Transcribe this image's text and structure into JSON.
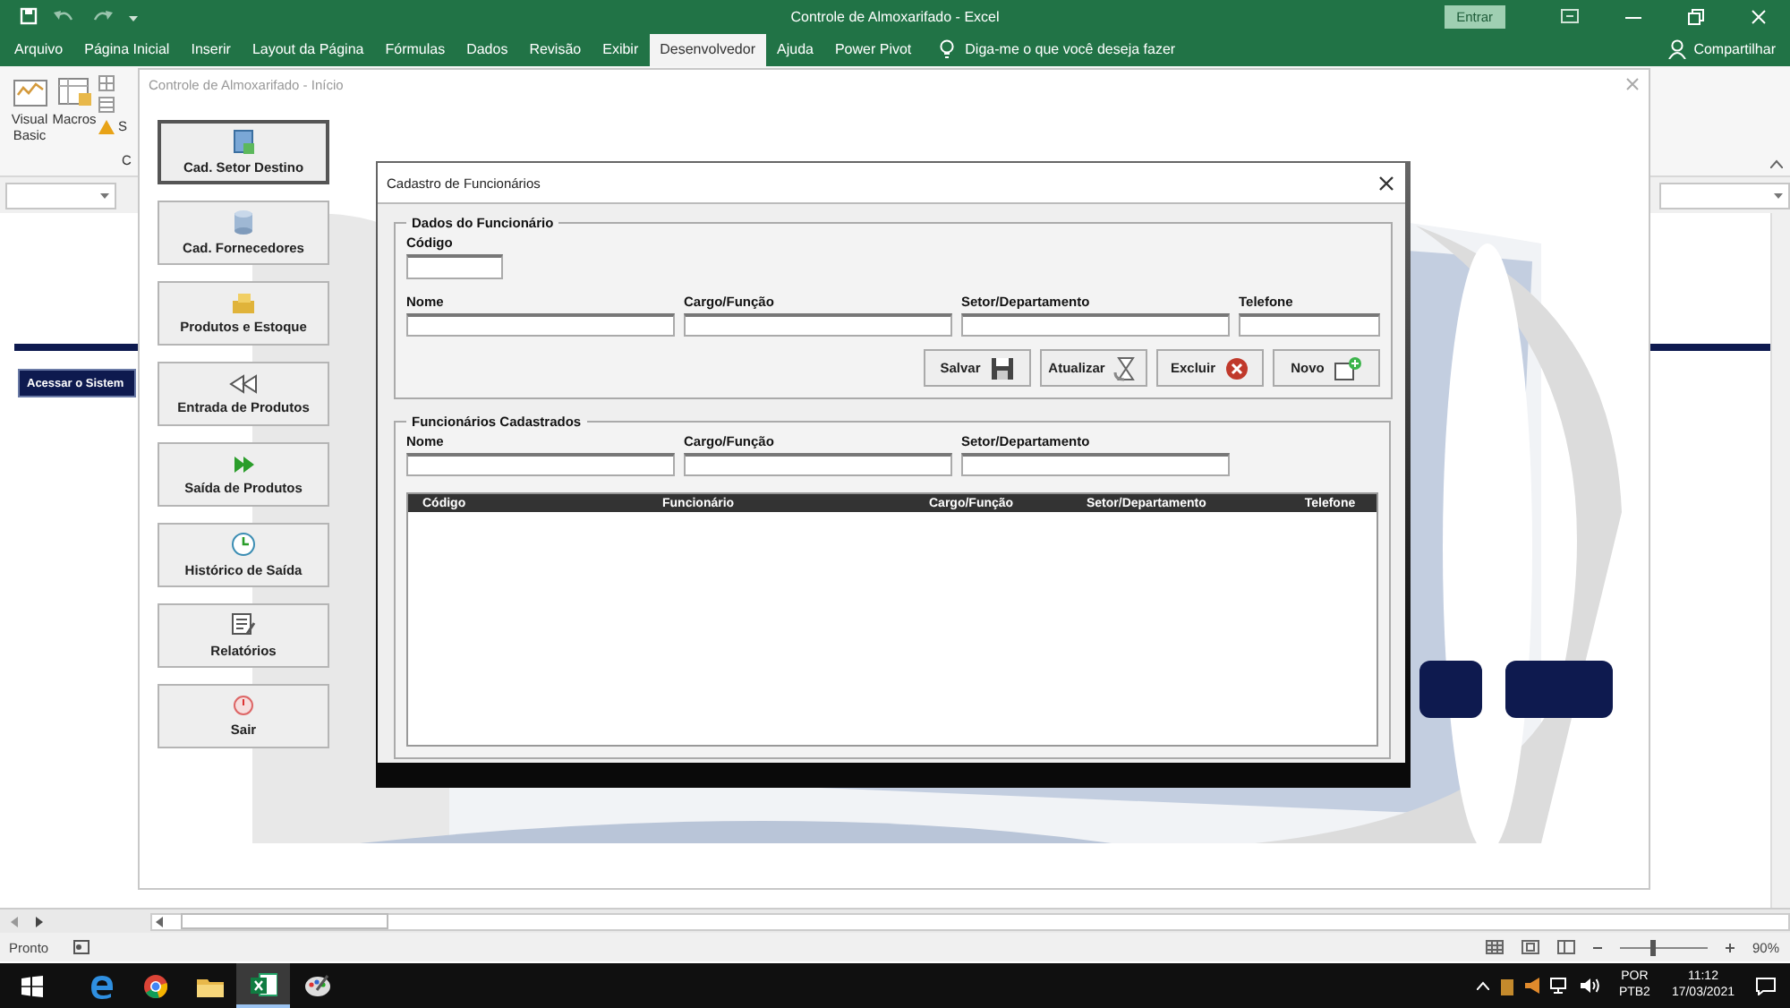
{
  "excel": {
    "title": "Controle de Almoxarifado - Excel",
    "signin": "Entrar",
    "ribbon_tabs": [
      {
        "label": "Arquivo",
        "selected": false
      },
      {
        "label": "Página Inicial",
        "selected": false
      },
      {
        "label": "Inserir",
        "selected": false
      },
      {
        "label": "Layout da Página",
        "selected": false
      },
      {
        "label": "Fórmulas",
        "selected": false
      },
      {
        "label": "Dados",
        "selected": false
      },
      {
        "label": "Revisão",
        "selected": false
      },
      {
        "label": "Exibir",
        "selected": false
      },
      {
        "label": "Desenvolvedor",
        "selected": true
      },
      {
        "label": "Ajuda",
        "selected": false
      },
      {
        "label": "Power Pivot",
        "selected": false
      }
    ],
    "tell_me": "Diga-me o que você deseja fazer",
    "share": "Compartilhar",
    "ribbon_buttons": [
      {
        "label": "Visual Basic",
        "kind": "vba"
      },
      {
        "label": "Macros",
        "kind": "macros"
      }
    ],
    "ribbon_small": "S",
    "group_label": "C",
    "sheet_button": "Acessar o Sistem",
    "status": "Pronto",
    "zoom": "90%",
    "zoom_slider": {
      "level": 0.37
    }
  },
  "form": {
    "title": "Controle de Almoxarifado - Início",
    "menu": [
      {
        "label": "Cad. Setor Destino",
        "kind": "sector",
        "focused": true
      },
      {
        "label": "Cad. Fornecedores",
        "kind": "supplier",
        "focused": false
      },
      {
        "label": "Produtos e Estoque",
        "kind": "products",
        "focused": false
      },
      {
        "label": "Entrada de Produtos",
        "kind": "entry",
        "focused": false
      },
      {
        "label": "Saída de Produtos",
        "kind": "exit",
        "focused": false
      },
      {
        "label": "Histórico de Saída",
        "kind": "history",
        "focused": false
      },
      {
        "label": "Relatórios",
        "kind": "reports",
        "focused": false
      },
      {
        "label": "Sair",
        "kind": "quit",
        "focused": false
      }
    ]
  },
  "dialog": {
    "title": "Cadastro de Funcionários",
    "details": {
      "legend": "Dados do Funcionário",
      "code_label": "Código",
      "fields": [
        {
          "label": "Nome"
        },
        {
          "label": "Cargo/Função"
        },
        {
          "label": "Setor/Departamento"
        },
        {
          "label": "Telefone"
        }
      ],
      "buttons": [
        {
          "label": "Salvar",
          "kind": "save"
        },
        {
          "label": "Atualizar",
          "kind": "refresh"
        },
        {
          "label": "Excluir",
          "kind": "delete"
        },
        {
          "label": "Novo",
          "kind": "new"
        }
      ]
    },
    "list": {
      "legend": "Funcionários Cadastrados",
      "filters": [
        "Nome",
        "Cargo/Função",
        "Setor/Departamento"
      ],
      "columns": [
        "Código",
        "Funcionário",
        "Cargo/Função",
        "Setor/Departamento",
        "Telefone"
      ]
    }
  },
  "taskbar": {
    "apps": [
      {
        "kind": "edge",
        "selected": false
      },
      {
        "kind": "chrome",
        "selected": false
      },
      {
        "kind": "folder",
        "selected": false
      },
      {
        "kind": "excel",
        "selected": true
      },
      {
        "kind": "paint",
        "selected": false
      }
    ],
    "language": "POR",
    "layout": "PTB2",
    "time": "11:12",
    "date": "17/03/2021"
  }
}
